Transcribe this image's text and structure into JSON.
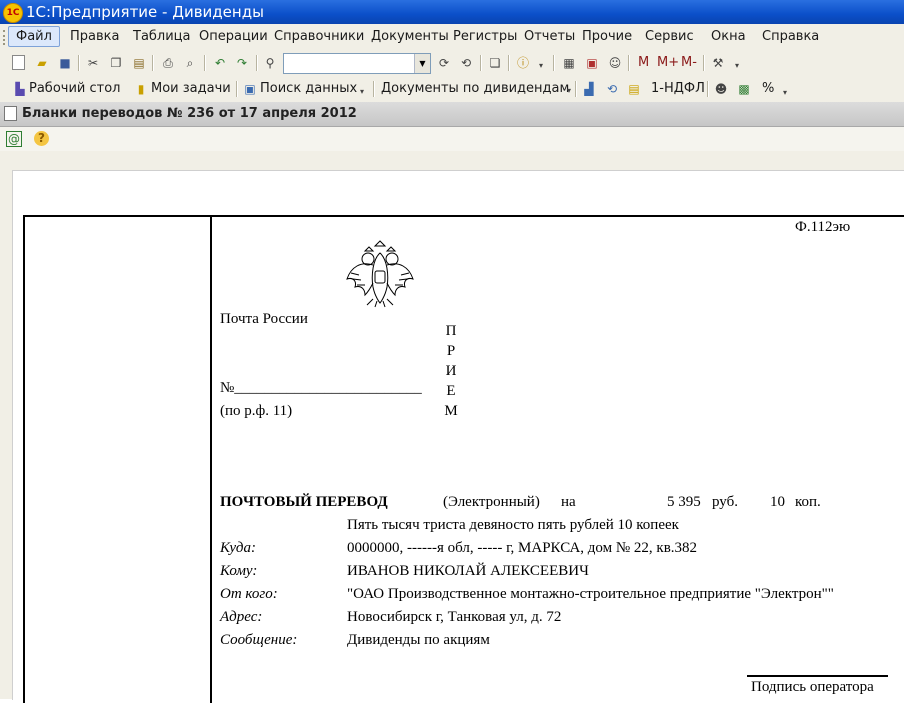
{
  "window": {
    "logo_text": "1C",
    "title": "1С:Предприятие - Дивиденды"
  },
  "menubar": {
    "items": [
      "Файл",
      "Правка",
      "Таблица",
      "Операции",
      "Справочники",
      "Документы",
      "Регистры",
      "Отчеты",
      "Прочие",
      "Сервис",
      "Окна",
      "Справка"
    ],
    "active_item": "Файл"
  },
  "toolbar1": {
    "search_value": "",
    "memory_buttons": [
      "M",
      "M+",
      "M-"
    ]
  },
  "toolbar2": {
    "desktop_label": "Рабочий стол",
    "tasks_label": "Мои задачи",
    "search_label": "Поиск данных",
    "dividend_docs_label": "Документы по дивидендам",
    "ndfl_label": "1-НДФЛ",
    "percent_label": "%"
  },
  "document": {
    "title": "Бланки переводов  № 236 от 17 апреля 2012"
  },
  "form": {
    "form_code": "Ф.112эю",
    "post_name": "Почта России",
    "number_label": "№_________________________",
    "reference": "(по р.ф. 11)",
    "vertical_word": [
      "П",
      "Р",
      "И",
      "Е",
      "М"
    ],
    "transfer_heading": "ПОЧТОВЫЙ ПЕРЕВОД",
    "transfer_type": "(Электронный)",
    "on_label": "на",
    "amount_rub": "5 395",
    "rub_label": "руб.",
    "amount_kop": "10",
    "kop_label": "коп.",
    "amount_words": "Пять тысяч триста девяносто пять рублей 10 копеек",
    "fields": [
      {
        "label": "Куда:",
        "value": "0000000, ------я обл, ----- г, МАРКСА, дом № 22, кв.382"
      },
      {
        "label": "Кому:",
        "value": "ИВАНОВ НИКОЛАЙ АЛЕКСЕЕВИЧ"
      },
      {
        "label": "От кого:",
        "value": "\"ОАО Производственное монтажно-строительное предприятие \"Электрон\"\""
      },
      {
        "label": "Адрес:",
        "value": " Новосибирск г,  Танковая ул,  д. 72"
      },
      {
        "label": "Сообщение:",
        "value": "Дивиденды по акциям"
      }
    ],
    "signature_label": "Подпись оператора"
  }
}
